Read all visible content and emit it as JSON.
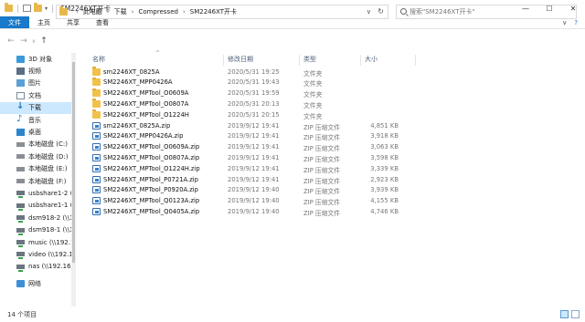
{
  "window": {
    "title": "SM2246XT开卡",
    "minimize": "—",
    "maximize": "☐",
    "close": "✕"
  },
  "ribbon": {
    "tabs": [
      "文件",
      "主页",
      "共享",
      "查看"
    ],
    "expand": "∨",
    "help": "?"
  },
  "address": {
    "back": "←",
    "forward": "→",
    "recent": "∨",
    "up": "↑",
    "breadcrumbs": [
      "此电脑",
      "下载",
      "Compressed",
      "SM2246XT开卡"
    ],
    "dropdown": "∨",
    "refresh": "↻",
    "search_placeholder": "搜索\"SM2246XT开卡\""
  },
  "nav": {
    "items": [
      {
        "label": "3D 对象",
        "icon": "cube-icon"
      },
      {
        "label": "视频",
        "icon": "video-icon"
      },
      {
        "label": "图片",
        "icon": "picture-icon"
      },
      {
        "label": "文档",
        "icon": "document-icon"
      },
      {
        "label": "下载",
        "icon": "download-icon",
        "selected": true
      },
      {
        "label": "音乐",
        "icon": "music-icon"
      },
      {
        "label": "桌面",
        "icon": "desktop-icon"
      },
      {
        "label": "本地磁盘 (C:)",
        "icon": "drive-icon"
      },
      {
        "label": "本地磁盘 (D:)",
        "icon": "drive-icon"
      },
      {
        "label": "本地磁盘 (E:)",
        "icon": "drive-icon"
      },
      {
        "label": "本地磁盘 (F:)",
        "icon": "drive-icon"
      },
      {
        "label": "usbshare1-2 (\\\\",
        "icon": "network-drive-icon"
      },
      {
        "label": "usbshare1-1 (\\\\",
        "icon": "network-drive-icon"
      },
      {
        "label": "dsm918-2 (\\\\19",
        "icon": "network-drive-icon"
      },
      {
        "label": "dsm918-1 (\\\\19",
        "icon": "network-drive-icon"
      },
      {
        "label": "music (\\\\192.16",
        "icon": "network-drive-icon"
      },
      {
        "label": "video (\\\\192.16",
        "icon": "network-drive-icon"
      },
      {
        "label": "nas (\\\\192.168.",
        "icon": "network-drive-icon"
      },
      {
        "label": "网络",
        "icon": "network-icon"
      }
    ]
  },
  "list": {
    "columns": {
      "name": "名称",
      "date": "修改日期",
      "type": "类型",
      "size": "大小"
    },
    "sort_indicator": "^",
    "rows": [
      {
        "name": "sm2246XT_0825A",
        "date": "2020/5/31 19:25",
        "type": "文件夹",
        "size": "",
        "kind": "folder"
      },
      {
        "name": "SM2246XT_MPP0426A",
        "date": "2020/5/31 19:43",
        "type": "文件夹",
        "size": "",
        "kind": "folder"
      },
      {
        "name": "SM2246XT_MPTool_O0609A",
        "date": "2020/5/31 19:59",
        "type": "文件夹",
        "size": "",
        "kind": "folder"
      },
      {
        "name": "SM2246XT_MPTool_O0807A",
        "date": "2020/5/31 20:13",
        "type": "文件夹",
        "size": "",
        "kind": "folder"
      },
      {
        "name": "SM2246XT_MPTool_O1224H",
        "date": "2020/5/31 20:15",
        "type": "文件夹",
        "size": "",
        "kind": "folder"
      },
      {
        "name": "sm2246XT_0825A.zip",
        "date": "2019/9/12 19:41",
        "type": "ZIP 压缩文件",
        "size": "4,851 KB",
        "kind": "zip"
      },
      {
        "name": "SM2246XT_MPP0426A.zip",
        "date": "2019/9/12 19:41",
        "type": "ZIP 压缩文件",
        "size": "3,918 KB",
        "kind": "zip"
      },
      {
        "name": "SM2246XT_MPTool_O0609A.zip",
        "date": "2019/9/12 19:41",
        "type": "ZIP 压缩文件",
        "size": "3,063 KB",
        "kind": "zip"
      },
      {
        "name": "SM2246XT_MPTool_O0807A.zip",
        "date": "2019/9/12 19:41",
        "type": "ZIP 压缩文件",
        "size": "3,598 KB",
        "kind": "zip"
      },
      {
        "name": "SM2246XT_MPTool_O1224H.zip",
        "date": "2019/9/12 19:41",
        "type": "ZIP 压缩文件",
        "size": "3,339 KB",
        "kind": "zip"
      },
      {
        "name": "SM2246XT_MPTool_P0721A.zip",
        "date": "2019/9/12 19:41",
        "type": "ZIP 压缩文件",
        "size": "2,923 KB",
        "kind": "zip"
      },
      {
        "name": "SM2246XT_MPTool_P0920A.zip",
        "date": "2019/9/12 19:40",
        "type": "ZIP 压缩文件",
        "size": "3,939 KB",
        "kind": "zip"
      },
      {
        "name": "SM2246XT_MPTool_Q0123A.zip",
        "date": "2019/9/12 19:40",
        "type": "ZIP 压缩文件",
        "size": "4,155 KB",
        "kind": "zip"
      },
      {
        "name": "SM2246XT_MPTool_Q0405A.zip",
        "date": "2019/9/12 19:40",
        "type": "ZIP 压缩文件",
        "size": "4,746 KB",
        "kind": "zip"
      }
    ]
  },
  "status": {
    "count": "14 个项目"
  }
}
